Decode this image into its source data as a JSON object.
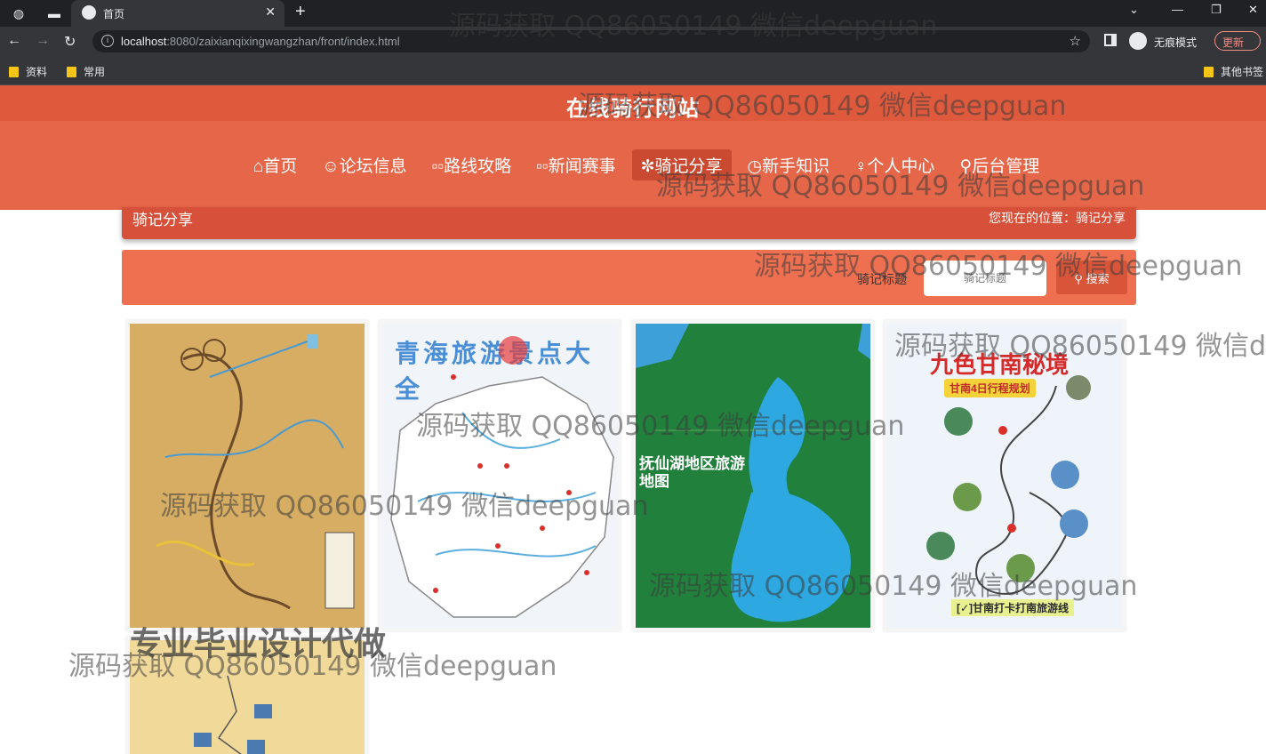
{
  "browser": {
    "tab_title": "首页",
    "url_host": "localhost",
    "url_rest": ":8080/zaixianqixingwangzhan/front/index.html",
    "profile_label": "无痕模式",
    "update_label": "更新",
    "bookmarks": [
      "资料",
      "常用"
    ],
    "other_bookmarks": "其他书签"
  },
  "site": {
    "title": "在线骑行网站",
    "menu": [
      {
        "label": "⌂首页",
        "active": false
      },
      {
        "label": "☺论坛信息",
        "active": false
      },
      {
        "label": "▫▫路线攻略",
        "active": false
      },
      {
        "label": "▫▫新闻赛事",
        "active": false
      },
      {
        "label": "✼骑记分享",
        "active": true
      },
      {
        "label": "◷新手知识",
        "active": false
      },
      {
        "label": "♀个人中心",
        "active": false
      },
      {
        "label": "⚲后台管理",
        "active": false
      }
    ]
  },
  "breadcrumb": {
    "title": "骑记分享",
    "location": "您现在的位置：骑记分享"
  },
  "search": {
    "label": "骑记标题",
    "placeholder": "骑记标题",
    "button": "搜索"
  },
  "cards": [
    {
      "map_title": "",
      "theme": "tan"
    },
    {
      "map_title": "青海旅游景点大全",
      "theme": "light"
    },
    {
      "map_title": "抚仙湖地区旅游地图",
      "theme": "green"
    },
    {
      "map_title": "九色甘南秘境",
      "subtitle": "甘南4日行程规划",
      "footer": "[✓]甘南打卡打南旅游线",
      "theme": "white"
    },
    {
      "map_title": "",
      "theme": "tan"
    }
  ],
  "overlay_text": "专业毕业设计代做",
  "watermarks": [
    "源码获取 QQ86050149 微信deepguan",
    "源码获取 QQ86050149 微信deepguan",
    "源码获取 QQ86050149 微信deepguan",
    "源码获取 QQ86050149 微信deepguan",
    "源码获取 QQ86050149 微信de",
    "源码获取 QQ86050149 微信deepguan",
    "源码获取 QQ86050149 微信deepguan",
    "源码获取 QQ86050149 微信deepguan",
    "源码获取 QQ86050149 微信deepguan"
  ]
}
